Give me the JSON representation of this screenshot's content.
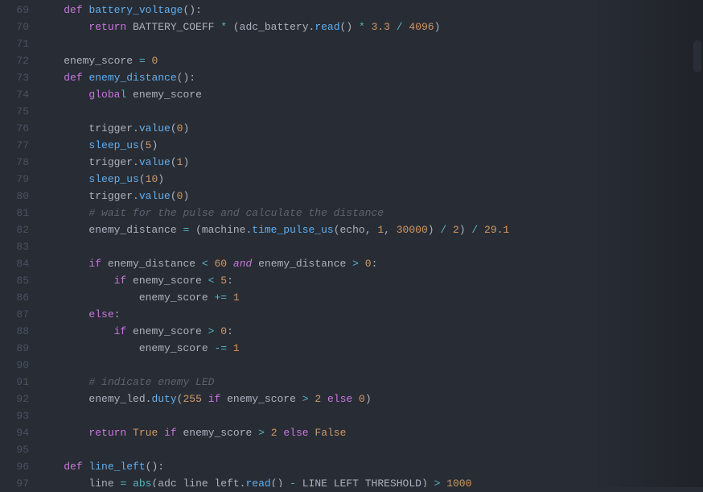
{
  "startLine": 69,
  "lines": [
    {
      "indent": 1,
      "tokens": [
        {
          "t": "kw",
          "s": "def"
        },
        {
          "t": "pn",
          "s": " "
        },
        {
          "t": "fn",
          "s": "battery_voltage"
        },
        {
          "t": "pn",
          "s": "():"
        }
      ]
    },
    {
      "indent": 2,
      "tokens": [
        {
          "t": "kw",
          "s": "return"
        },
        {
          "t": "pn",
          "s": " BATTERY_COEFF "
        },
        {
          "t": "op",
          "s": "*"
        },
        {
          "t": "pn",
          "s": " (adc_battery"
        },
        {
          "t": "pn",
          "s": "."
        },
        {
          "t": "call",
          "s": "read"
        },
        {
          "t": "pn",
          "s": "() "
        },
        {
          "t": "op",
          "s": "*"
        },
        {
          "t": "pn",
          "s": " "
        },
        {
          "t": "num",
          "s": "3.3"
        },
        {
          "t": "pn",
          "s": " "
        },
        {
          "t": "op",
          "s": "/"
        },
        {
          "t": "pn",
          "s": " "
        },
        {
          "t": "num",
          "s": "4096"
        },
        {
          "t": "pn",
          "s": ")"
        }
      ]
    },
    {
      "indent": 0,
      "tokens": []
    },
    {
      "indent": 1,
      "tokens": [
        {
          "t": "pn",
          "s": "enemy_score "
        },
        {
          "t": "op",
          "s": "="
        },
        {
          "t": "pn",
          "s": " "
        },
        {
          "t": "num",
          "s": "0"
        }
      ]
    },
    {
      "indent": 1,
      "tokens": [
        {
          "t": "kw",
          "s": "def"
        },
        {
          "t": "pn",
          "s": " "
        },
        {
          "t": "fn",
          "s": "enemy_distance"
        },
        {
          "t": "pn",
          "s": "():"
        }
      ]
    },
    {
      "indent": 2,
      "tokens": [
        {
          "t": "kw",
          "s": "globa"
        },
        {
          "t": "op",
          "s": "l"
        },
        {
          "t": "pn",
          "s": " enemy_score"
        }
      ]
    },
    {
      "indent": 0,
      "tokens": []
    },
    {
      "indent": 2,
      "tokens": [
        {
          "t": "pn",
          "s": "trigger."
        },
        {
          "t": "call",
          "s": "value"
        },
        {
          "t": "pn",
          "s": "("
        },
        {
          "t": "num",
          "s": "0"
        },
        {
          "t": "pn",
          "s": ")"
        }
      ]
    },
    {
      "indent": 2,
      "tokens": [
        {
          "t": "call",
          "s": "sleep_us"
        },
        {
          "t": "pn",
          "s": "("
        },
        {
          "t": "num",
          "s": "5"
        },
        {
          "t": "pn",
          "s": ")"
        }
      ]
    },
    {
      "indent": 2,
      "tokens": [
        {
          "t": "pn",
          "s": "trigger."
        },
        {
          "t": "call",
          "s": "value"
        },
        {
          "t": "pn",
          "s": "("
        },
        {
          "t": "num",
          "s": "1"
        },
        {
          "t": "pn",
          "s": ")"
        }
      ]
    },
    {
      "indent": 2,
      "tokens": [
        {
          "t": "call",
          "s": "sleep_us"
        },
        {
          "t": "pn",
          "s": "("
        },
        {
          "t": "num",
          "s": "10"
        },
        {
          "t": "pn",
          "s": ")"
        }
      ]
    },
    {
      "indent": 2,
      "tokens": [
        {
          "t": "pn",
          "s": "trigger."
        },
        {
          "t": "call",
          "s": "value"
        },
        {
          "t": "pn",
          "s": "("
        },
        {
          "t": "num",
          "s": "0"
        },
        {
          "t": "pn",
          "s": ")"
        }
      ]
    },
    {
      "indent": 2,
      "tokens": [
        {
          "t": "cmt",
          "s": "# wait for the pulse and calculate the distance"
        }
      ]
    },
    {
      "indent": 2,
      "tokens": [
        {
          "t": "pn",
          "s": "enemy_distance "
        },
        {
          "t": "op",
          "s": "="
        },
        {
          "t": "pn",
          "s": " (machine."
        },
        {
          "t": "call",
          "s": "time_pulse_us"
        },
        {
          "t": "pn",
          "s": "(echo, "
        },
        {
          "t": "num",
          "s": "1"
        },
        {
          "t": "pn",
          "s": ", "
        },
        {
          "t": "num",
          "s": "30000"
        },
        {
          "t": "pn",
          "s": ") "
        },
        {
          "t": "op",
          "s": "/"
        },
        {
          "t": "pn",
          "s": " "
        },
        {
          "t": "num",
          "s": "2"
        },
        {
          "t": "pn",
          "s": ") "
        },
        {
          "t": "op",
          "s": "/"
        },
        {
          "t": "pn",
          "s": " "
        },
        {
          "t": "num",
          "s": "29.1"
        }
      ]
    },
    {
      "indent": 0,
      "tokens": []
    },
    {
      "indent": 2,
      "tokens": [
        {
          "t": "kw",
          "s": "if"
        },
        {
          "t": "pn",
          "s": " enemy_distance "
        },
        {
          "t": "op",
          "s": "<"
        },
        {
          "t": "pn",
          "s": " "
        },
        {
          "t": "num",
          "s": "60"
        },
        {
          "t": "pn",
          "s": " "
        },
        {
          "t": "kw2",
          "s": "and"
        },
        {
          "t": "pn",
          "s": " enemy_distance "
        },
        {
          "t": "op",
          "s": ">"
        },
        {
          "t": "pn",
          "s": " "
        },
        {
          "t": "num",
          "s": "0"
        },
        {
          "t": "pn",
          "s": ":"
        }
      ]
    },
    {
      "indent": 3,
      "tokens": [
        {
          "t": "kw",
          "s": "if"
        },
        {
          "t": "pn",
          "s": " enemy_score "
        },
        {
          "t": "op",
          "s": "<"
        },
        {
          "t": "pn",
          "s": " "
        },
        {
          "t": "num",
          "s": "5"
        },
        {
          "t": "pn",
          "s": ":"
        }
      ]
    },
    {
      "indent": 4,
      "tokens": [
        {
          "t": "pn",
          "s": "enemy_score "
        },
        {
          "t": "op",
          "s": "+="
        },
        {
          "t": "pn",
          "s": " "
        },
        {
          "t": "num",
          "s": "1"
        }
      ]
    },
    {
      "indent": 2,
      "tokens": [
        {
          "t": "kw",
          "s": "else"
        },
        {
          "t": "pn",
          "s": ":"
        }
      ]
    },
    {
      "indent": 3,
      "tokens": [
        {
          "t": "kw",
          "s": "if"
        },
        {
          "t": "pn",
          "s": " enemy_score "
        },
        {
          "t": "op",
          "s": ">"
        },
        {
          "t": "pn",
          "s": " "
        },
        {
          "t": "num",
          "s": "0"
        },
        {
          "t": "pn",
          "s": ":"
        }
      ]
    },
    {
      "indent": 4,
      "tokens": [
        {
          "t": "pn",
          "s": "enemy_score "
        },
        {
          "t": "op",
          "s": "-="
        },
        {
          "t": "pn",
          "s": " "
        },
        {
          "t": "num",
          "s": "1"
        }
      ]
    },
    {
      "indent": 0,
      "tokens": []
    },
    {
      "indent": 2,
      "tokens": [
        {
          "t": "cmt",
          "s": "# indicate enemy LED"
        }
      ]
    },
    {
      "indent": 2,
      "tokens": [
        {
          "t": "pn",
          "s": "enemy_led."
        },
        {
          "t": "call",
          "s": "duty"
        },
        {
          "t": "pn",
          "s": "("
        },
        {
          "t": "num",
          "s": "255"
        },
        {
          "t": "pn",
          "s": " "
        },
        {
          "t": "kw",
          "s": "if"
        },
        {
          "t": "pn",
          "s": " enemy_score "
        },
        {
          "t": "op",
          "s": ">"
        },
        {
          "t": "pn",
          "s": " "
        },
        {
          "t": "num",
          "s": "2"
        },
        {
          "t": "pn",
          "s": " "
        },
        {
          "t": "kw",
          "s": "else"
        },
        {
          "t": "pn",
          "s": " "
        },
        {
          "t": "num",
          "s": "0"
        },
        {
          "t": "pn",
          "s": ")"
        }
      ]
    },
    {
      "indent": 0,
      "tokens": []
    },
    {
      "indent": 2,
      "tokens": [
        {
          "t": "kw",
          "s": "return"
        },
        {
          "t": "pn",
          "s": " "
        },
        {
          "t": "cst",
          "s": "True"
        },
        {
          "t": "pn",
          "s": " "
        },
        {
          "t": "kw",
          "s": "if"
        },
        {
          "t": "pn",
          "s": " enemy_score "
        },
        {
          "t": "op",
          "s": ">"
        },
        {
          "t": "pn",
          "s": " "
        },
        {
          "t": "num",
          "s": "2"
        },
        {
          "t": "pn",
          "s": " "
        },
        {
          "t": "kw",
          "s": "else"
        },
        {
          "t": "pn",
          "s": " "
        },
        {
          "t": "cst",
          "s": "False"
        }
      ]
    },
    {
      "indent": 0,
      "tokens": []
    },
    {
      "indent": 1,
      "tokens": [
        {
          "t": "kw",
          "s": "def"
        },
        {
          "t": "pn",
          "s": " "
        },
        {
          "t": "fn",
          "s": "line_left"
        },
        {
          "t": "pn",
          "s": "():"
        }
      ]
    },
    {
      "indent": 2,
      "tokens": [
        {
          "t": "pn",
          "s": "line "
        },
        {
          "t": "op",
          "s": "="
        },
        {
          "t": "pn",
          "s": " "
        },
        {
          "t": "builtin",
          "s": "abs"
        },
        {
          "t": "pn",
          "s": "(adc_line_left."
        },
        {
          "t": "call",
          "s": "read"
        },
        {
          "t": "pn",
          "s": "() "
        },
        {
          "t": "op",
          "s": "-"
        },
        {
          "t": "pn",
          "s": " LINE_LEFT_THRESHOLD) "
        },
        {
          "t": "op",
          "s": ">"
        },
        {
          "t": "pn",
          "s": " "
        },
        {
          "t": "num",
          "s": "1000"
        }
      ]
    }
  ]
}
